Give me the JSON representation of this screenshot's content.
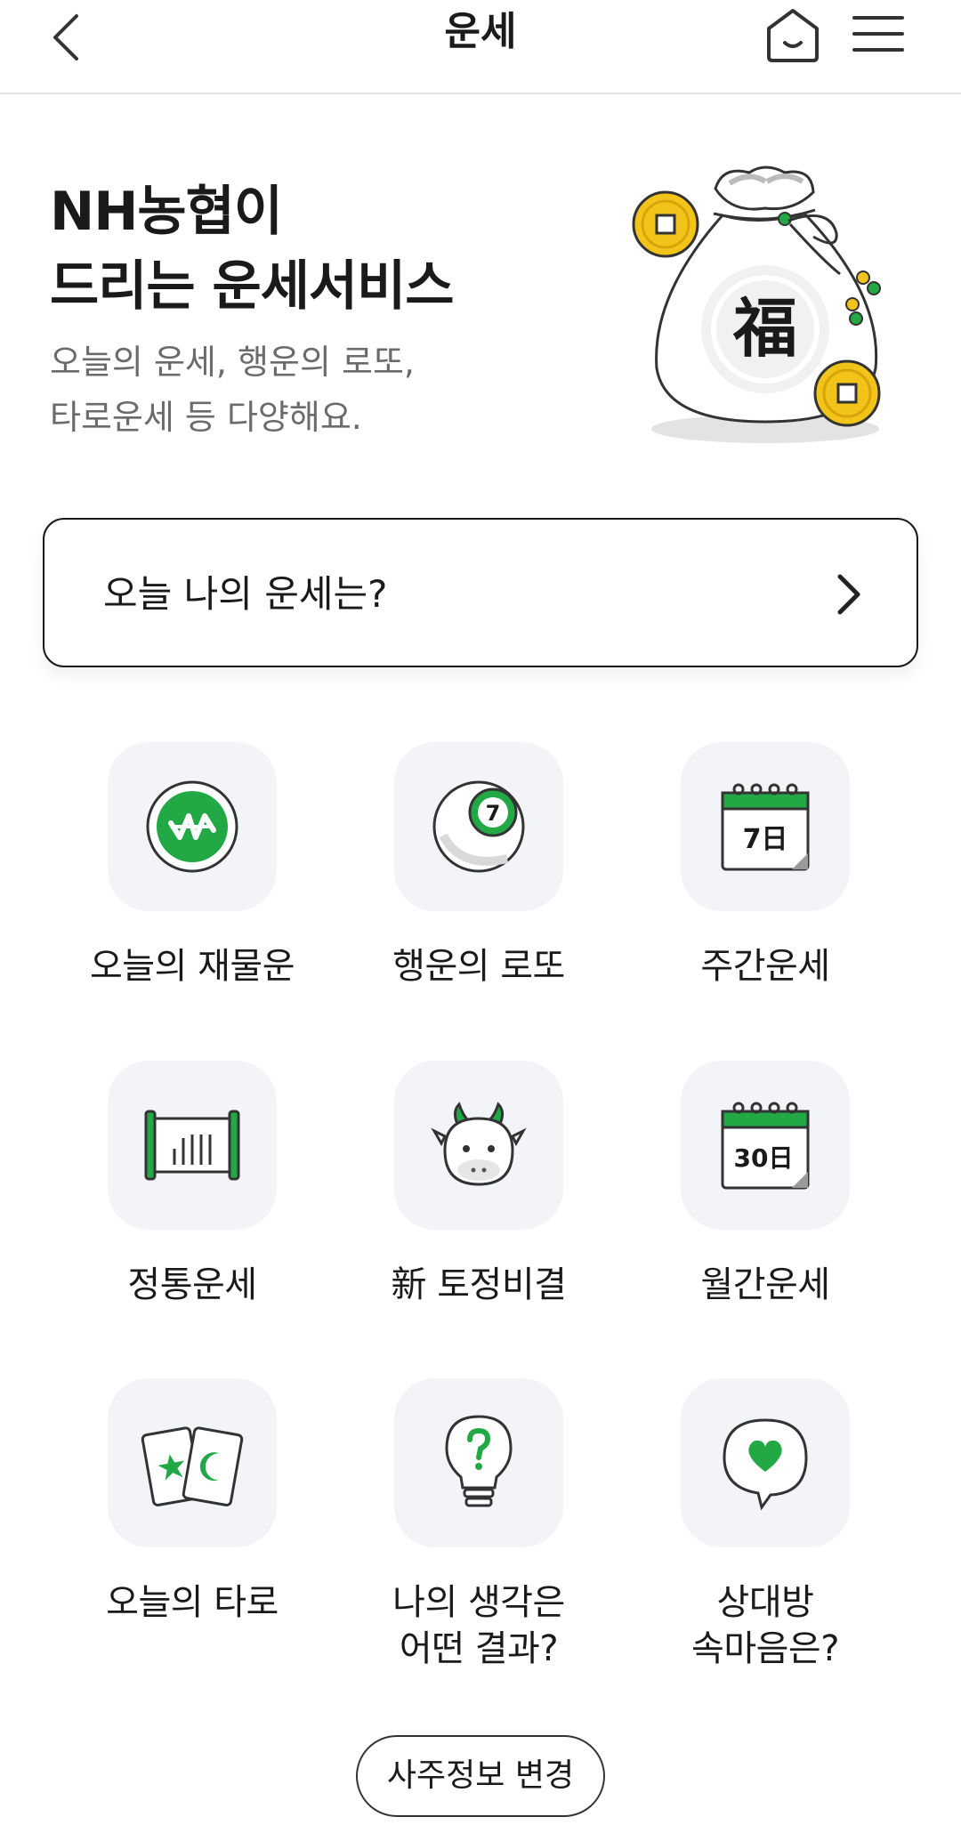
{
  "header": {
    "title": "운세",
    "back_icon": "chevron-left-icon",
    "home_icon": "home-icon",
    "menu_icon": "hamburger-menu-icon"
  },
  "hero": {
    "title_line1": "NH농협이",
    "title_line2": "드리는 운세서비스",
    "subtitle_line1": "오늘의 운세, 행운의 로또,",
    "subtitle_line2": "타로운세 등 다양해요.",
    "bag_character": "福"
  },
  "today_fortune": {
    "label": "오늘 나의 운세는?"
  },
  "services": [
    {
      "label": "오늘의 재물운",
      "icon": "won-coin-icon"
    },
    {
      "label": "행운의 로또",
      "icon": "lotto-ball-icon",
      "ball_number": "7"
    },
    {
      "label": "주간운세",
      "icon": "calendar-7-icon",
      "calendar_text": "7日"
    },
    {
      "label": "정통운세",
      "icon": "scroll-icon"
    },
    {
      "label": "新 토정비결",
      "icon": "cow-icon"
    },
    {
      "label": "월간운세",
      "icon": "calendar-30-icon",
      "calendar_text": "30日"
    },
    {
      "label": "오늘의 타로",
      "icon": "tarot-cards-icon"
    },
    {
      "label": "나의 생각은\n어떤 결과?",
      "icon": "lightbulb-question-icon"
    },
    {
      "label": "상대방\n속마음은?",
      "icon": "heart-speech-bubble-icon"
    }
  ],
  "footer": {
    "change_saju_button": "사주정보 변경"
  },
  "colors": {
    "accent_green": "#22a845",
    "gold": "#f2c318",
    "tile_bg": "#f3f4f7"
  }
}
